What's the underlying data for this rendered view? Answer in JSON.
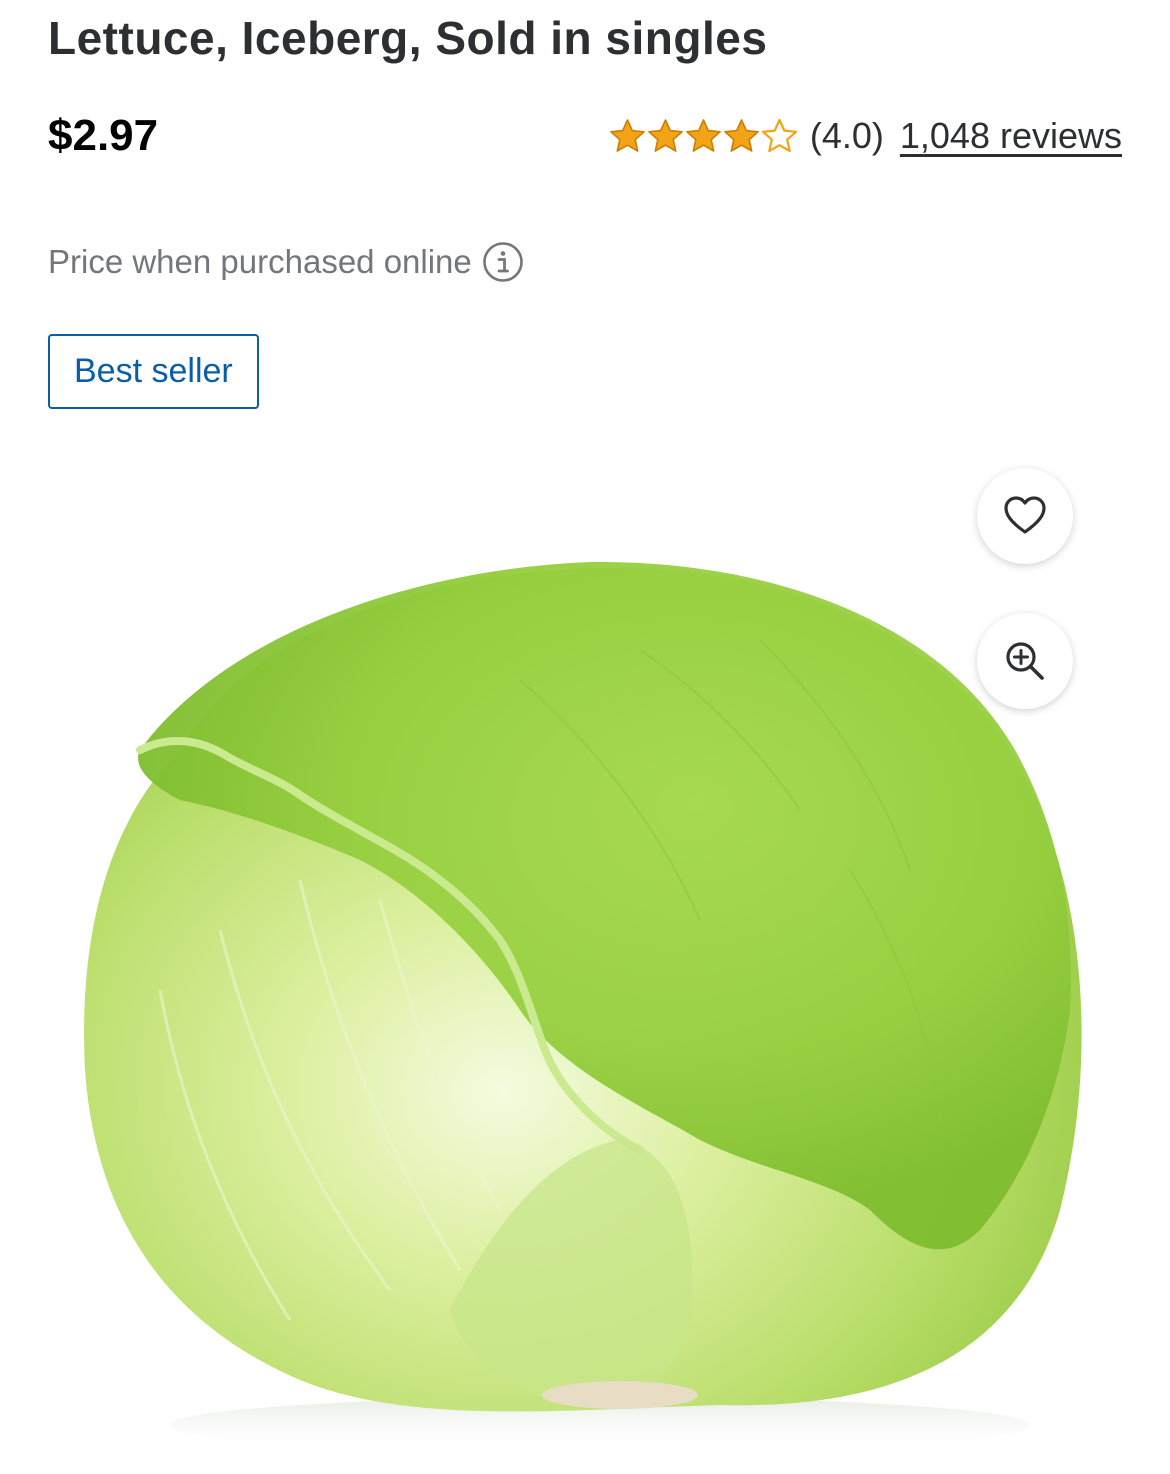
{
  "product": {
    "title": "Lettuce, Iceberg, Sold in singles",
    "price": "$2.97",
    "rating": {
      "stars": 4,
      "max_stars": 5,
      "value_text": "(4.0)",
      "reviews_text": "1,048 reviews"
    },
    "price_note": "Price when purchased online",
    "badge": "Best seller"
  },
  "icons": {
    "star_filled": "star-filled-icon",
    "star_empty": "star-outline-icon",
    "info": "info-icon",
    "favorite": "heart-icon",
    "zoom": "zoom-in-icon"
  },
  "colors": {
    "star": "#f2a316",
    "badge_blue": "#0a5ea8",
    "text_dark": "#2e2f32",
    "text_muted": "#74767c",
    "lettuce_light": "#e6f4c4",
    "lettuce_mid": "#b3dc6a",
    "lettuce_dark": "#86c43a"
  }
}
